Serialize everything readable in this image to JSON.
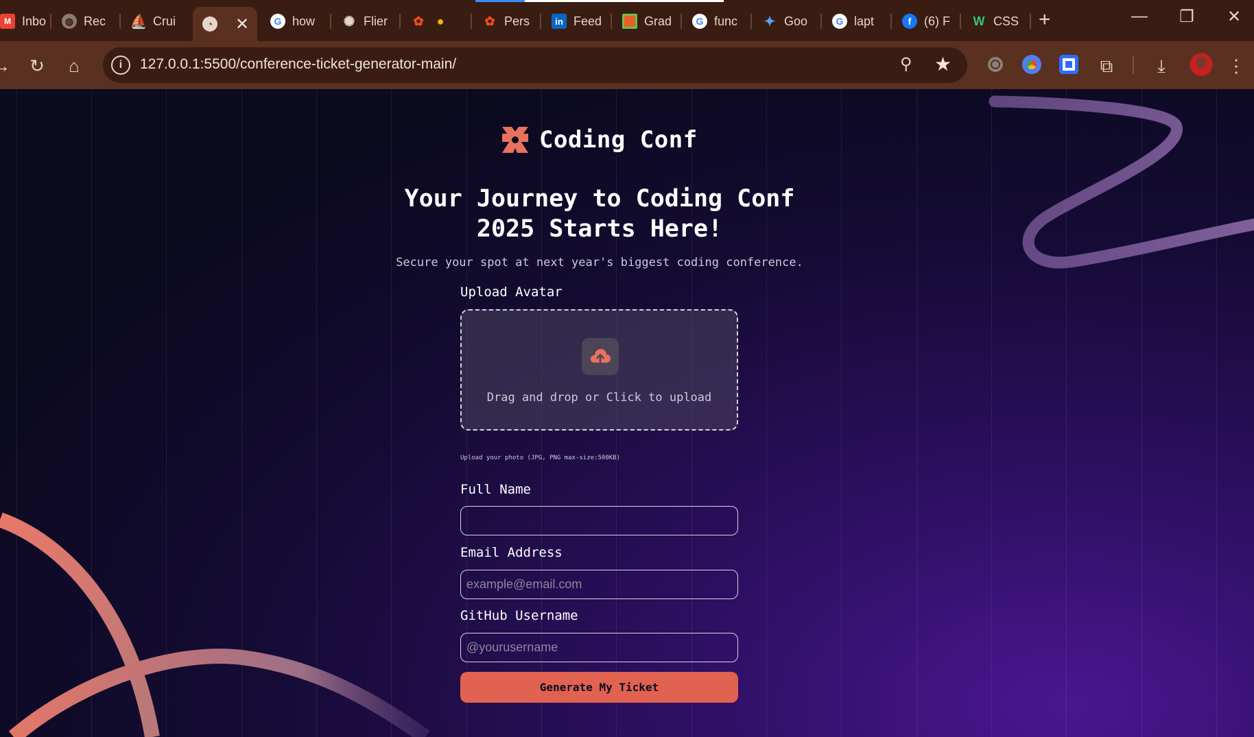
{
  "browser": {
    "tabs": [
      {
        "label": "Inbo",
        "icon": "gmail-icon"
      },
      {
        "label": "Rec",
        "icon": "globe-icon"
      },
      {
        "label": "Crui",
        "icon": "cruise-icon"
      },
      {
        "label": "",
        "icon": "page-icon",
        "active": true
      },
      {
        "label": "how",
        "icon": "google-icon"
      },
      {
        "label": "Flier",
        "icon": "chatgpt-icon"
      },
      {
        "label": "",
        "icon": "figma-icon"
      },
      {
        "label": "Pers",
        "icon": "figma-icon"
      },
      {
        "label": "Feed",
        "icon": "linkedin-icon"
      },
      {
        "label": "Grad",
        "icon": "box-icon"
      },
      {
        "label": "func",
        "icon": "google-icon"
      },
      {
        "label": "Goo",
        "icon": "gemini-icon"
      },
      {
        "label": "lapt",
        "icon": "google-icon"
      },
      {
        "label": "(6) F",
        "icon": "facebook-icon"
      },
      {
        "label": "CSS",
        "icon": "w3-icon"
      }
    ],
    "url": "127.0.0.1:5500/conference-ticket-generator-main/"
  },
  "page": {
    "brand": "Coding Conf",
    "headline_line1": "Your Journey to Coding Conf",
    "headline_line2": "2025 Starts Here!",
    "subheadline": "Secure your spot at next year's biggest coding conference.",
    "avatar_label": "Upload Avatar",
    "dropzone_text": "Drag and drop or Click to upload",
    "avatar_hint": "Upload your photo (JPG, PNG max-size:500KB)",
    "name_label": "Full Name",
    "name_value": "",
    "email_label": "Email Address",
    "email_placeholder": "example@email.com",
    "github_label": "GitHub Username",
    "github_placeholder": "@yourusername",
    "submit_label": "Generate My Ticket"
  },
  "colors": {
    "accent": "#e16251",
    "chrome_dark": "#3a1d12",
    "chrome_toolbar": "#5a3020"
  }
}
